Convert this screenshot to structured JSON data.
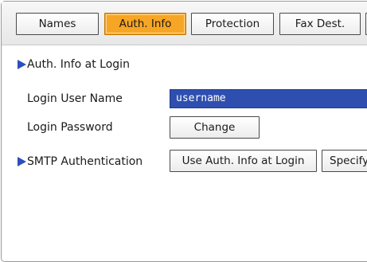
{
  "tabs": [
    {
      "label": "Names",
      "active": false
    },
    {
      "label": "Auth. Info",
      "active": true
    },
    {
      "label": "Protection",
      "active": false
    },
    {
      "label": "Fax Dest.",
      "active": false
    }
  ],
  "section_auth": {
    "title": "Auth. Info at Login",
    "login_user_name_label": "Login User Name",
    "login_user_name_value": "username",
    "login_password_label": "Login Password",
    "change_button": "Change"
  },
  "section_smtp": {
    "title": "SMTP Authentication",
    "use_auth_button": "Use Auth. Info at Login",
    "specify_button": "Specify"
  },
  "colors": {
    "active_tab": "#f6a524",
    "field_background": "#2e4fb0",
    "section_marker": "#2b4ec0"
  }
}
